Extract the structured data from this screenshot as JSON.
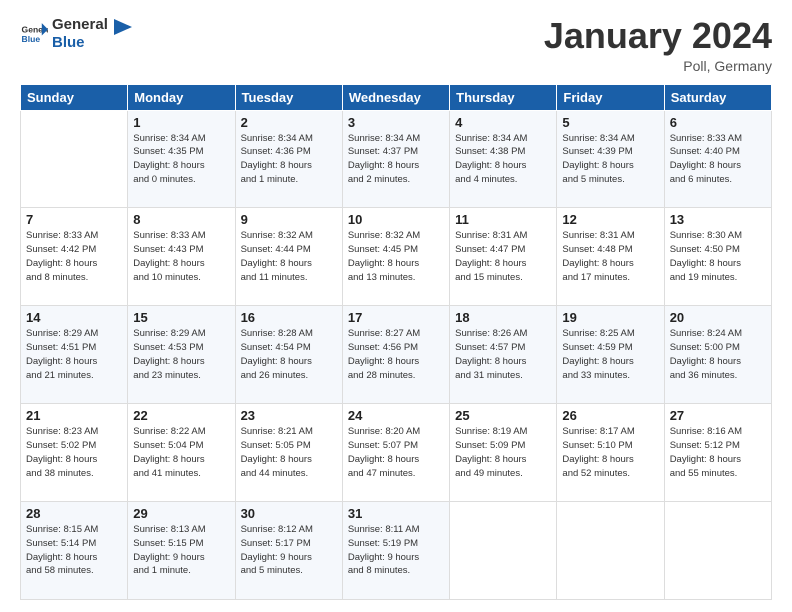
{
  "header": {
    "logo_general": "General",
    "logo_blue": "Blue",
    "month_title": "January 2024",
    "location": "Poll, Germany"
  },
  "days_of_week": [
    "Sunday",
    "Monday",
    "Tuesday",
    "Wednesday",
    "Thursday",
    "Friday",
    "Saturday"
  ],
  "weeks": [
    [
      {
        "day": "",
        "sunrise": "",
        "sunset": "",
        "daylight": ""
      },
      {
        "day": "1",
        "sunrise": "Sunrise: 8:34 AM",
        "sunset": "Sunset: 4:35 PM",
        "daylight": "Daylight: 8 hours and 0 minutes."
      },
      {
        "day": "2",
        "sunrise": "Sunrise: 8:34 AM",
        "sunset": "Sunset: 4:36 PM",
        "daylight": "Daylight: 8 hours and 1 minute."
      },
      {
        "day": "3",
        "sunrise": "Sunrise: 8:34 AM",
        "sunset": "Sunset: 4:37 PM",
        "daylight": "Daylight: 8 hours and 2 minutes."
      },
      {
        "day": "4",
        "sunrise": "Sunrise: 8:34 AM",
        "sunset": "Sunset: 4:38 PM",
        "daylight": "Daylight: 8 hours and 4 minutes."
      },
      {
        "day": "5",
        "sunrise": "Sunrise: 8:34 AM",
        "sunset": "Sunset: 4:39 PM",
        "daylight": "Daylight: 8 hours and 5 minutes."
      },
      {
        "day": "6",
        "sunrise": "Sunrise: 8:33 AM",
        "sunset": "Sunset: 4:40 PM",
        "daylight": "Daylight: 8 hours and 6 minutes."
      }
    ],
    [
      {
        "day": "7",
        "sunrise": "Sunrise: 8:33 AM",
        "sunset": "Sunset: 4:42 PM",
        "daylight": "Daylight: 8 hours and 8 minutes."
      },
      {
        "day": "8",
        "sunrise": "Sunrise: 8:33 AM",
        "sunset": "Sunset: 4:43 PM",
        "daylight": "Daylight: 8 hours and 10 minutes."
      },
      {
        "day": "9",
        "sunrise": "Sunrise: 8:32 AM",
        "sunset": "Sunset: 4:44 PM",
        "daylight": "Daylight: 8 hours and 11 minutes."
      },
      {
        "day": "10",
        "sunrise": "Sunrise: 8:32 AM",
        "sunset": "Sunset: 4:45 PM",
        "daylight": "Daylight: 8 hours and 13 minutes."
      },
      {
        "day": "11",
        "sunrise": "Sunrise: 8:31 AM",
        "sunset": "Sunset: 4:47 PM",
        "daylight": "Daylight: 8 hours and 15 minutes."
      },
      {
        "day": "12",
        "sunrise": "Sunrise: 8:31 AM",
        "sunset": "Sunset: 4:48 PM",
        "daylight": "Daylight: 8 hours and 17 minutes."
      },
      {
        "day": "13",
        "sunrise": "Sunrise: 8:30 AM",
        "sunset": "Sunset: 4:50 PM",
        "daylight": "Daylight: 8 hours and 19 minutes."
      }
    ],
    [
      {
        "day": "14",
        "sunrise": "Sunrise: 8:29 AM",
        "sunset": "Sunset: 4:51 PM",
        "daylight": "Daylight: 8 hours and 21 minutes."
      },
      {
        "day": "15",
        "sunrise": "Sunrise: 8:29 AM",
        "sunset": "Sunset: 4:53 PM",
        "daylight": "Daylight: 8 hours and 23 minutes."
      },
      {
        "day": "16",
        "sunrise": "Sunrise: 8:28 AM",
        "sunset": "Sunset: 4:54 PM",
        "daylight": "Daylight: 8 hours and 26 minutes."
      },
      {
        "day": "17",
        "sunrise": "Sunrise: 8:27 AM",
        "sunset": "Sunset: 4:56 PM",
        "daylight": "Daylight: 8 hours and 28 minutes."
      },
      {
        "day": "18",
        "sunrise": "Sunrise: 8:26 AM",
        "sunset": "Sunset: 4:57 PM",
        "daylight": "Daylight: 8 hours and 31 minutes."
      },
      {
        "day": "19",
        "sunrise": "Sunrise: 8:25 AM",
        "sunset": "Sunset: 4:59 PM",
        "daylight": "Daylight: 8 hours and 33 minutes."
      },
      {
        "day": "20",
        "sunrise": "Sunrise: 8:24 AM",
        "sunset": "Sunset: 5:00 PM",
        "daylight": "Daylight: 8 hours and 36 minutes."
      }
    ],
    [
      {
        "day": "21",
        "sunrise": "Sunrise: 8:23 AM",
        "sunset": "Sunset: 5:02 PM",
        "daylight": "Daylight: 8 hours and 38 minutes."
      },
      {
        "day": "22",
        "sunrise": "Sunrise: 8:22 AM",
        "sunset": "Sunset: 5:04 PM",
        "daylight": "Daylight: 8 hours and 41 minutes."
      },
      {
        "day": "23",
        "sunrise": "Sunrise: 8:21 AM",
        "sunset": "Sunset: 5:05 PM",
        "daylight": "Daylight: 8 hours and 44 minutes."
      },
      {
        "day": "24",
        "sunrise": "Sunrise: 8:20 AM",
        "sunset": "Sunset: 5:07 PM",
        "daylight": "Daylight: 8 hours and 47 minutes."
      },
      {
        "day": "25",
        "sunrise": "Sunrise: 8:19 AM",
        "sunset": "Sunset: 5:09 PM",
        "daylight": "Daylight: 8 hours and 49 minutes."
      },
      {
        "day": "26",
        "sunrise": "Sunrise: 8:17 AM",
        "sunset": "Sunset: 5:10 PM",
        "daylight": "Daylight: 8 hours and 52 minutes."
      },
      {
        "day": "27",
        "sunrise": "Sunrise: 8:16 AM",
        "sunset": "Sunset: 5:12 PM",
        "daylight": "Daylight: 8 hours and 55 minutes."
      }
    ],
    [
      {
        "day": "28",
        "sunrise": "Sunrise: 8:15 AM",
        "sunset": "Sunset: 5:14 PM",
        "daylight": "Daylight: 8 hours and 58 minutes."
      },
      {
        "day": "29",
        "sunrise": "Sunrise: 8:13 AM",
        "sunset": "Sunset: 5:15 PM",
        "daylight": "Daylight: 9 hours and 1 minute."
      },
      {
        "day": "30",
        "sunrise": "Sunrise: 8:12 AM",
        "sunset": "Sunset: 5:17 PM",
        "daylight": "Daylight: 9 hours and 5 minutes."
      },
      {
        "day": "31",
        "sunrise": "Sunrise: 8:11 AM",
        "sunset": "Sunset: 5:19 PM",
        "daylight": "Daylight: 9 hours and 8 minutes."
      },
      {
        "day": "",
        "sunrise": "",
        "sunset": "",
        "daylight": ""
      },
      {
        "day": "",
        "sunrise": "",
        "sunset": "",
        "daylight": ""
      },
      {
        "day": "",
        "sunrise": "",
        "sunset": "",
        "daylight": ""
      }
    ]
  ]
}
